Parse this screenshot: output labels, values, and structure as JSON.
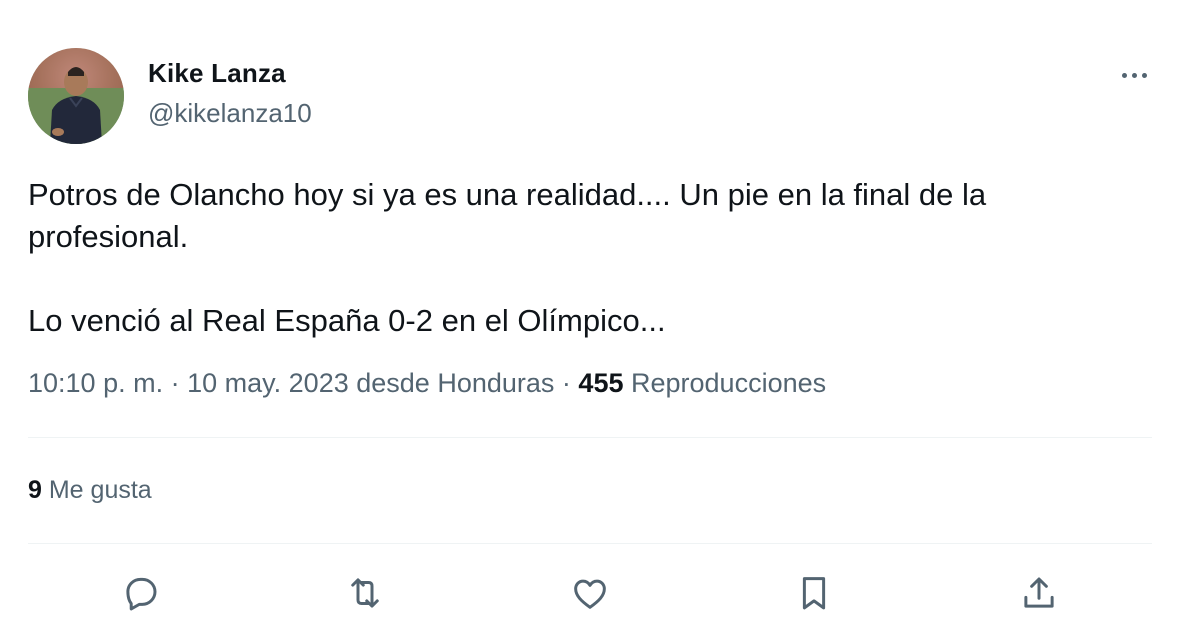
{
  "author": {
    "display_name": "Kike Lanza",
    "handle": "@kikelanza10"
  },
  "tweet": {
    "paragraphs": [
      "Potros de Olancho hoy si ya es una realidad....  Un pie en la final de la profesional.",
      "Lo venció al Real España 0-2 en el Olímpico..."
    ]
  },
  "meta": {
    "time": "10:10 p. m.",
    "separator": "·",
    "date": "10 may. 2023",
    "location": "desde Honduras",
    "views_count": "455",
    "views_label": "Reproducciones"
  },
  "engagement": {
    "likes_count": "9",
    "likes_label": "Me gusta"
  },
  "actions": {
    "icons": [
      "reply-icon",
      "retweet-icon",
      "like-icon",
      "bookmark-icon",
      "share-icon"
    ]
  },
  "colors": {
    "text_primary": "#0f1419",
    "text_secondary": "#536471",
    "divider": "#eff3f4"
  }
}
